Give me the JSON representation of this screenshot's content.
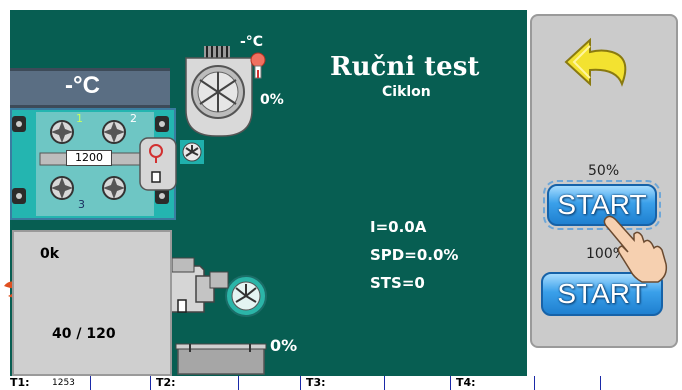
{
  "title": "Ručni test",
  "subtitle": "Ciklon",
  "boiler": {
    "temp": "-°C",
    "fan_speed": "1200",
    "pos": [
      "1",
      "2",
      "3"
    ],
    "fan_temp": "-°C",
    "fan_percent": "0%"
  },
  "burner": {
    "power": "0k",
    "level": "40 / 120",
    "feeder_percent": "0%",
    "motor_label": "▯"
  },
  "readings": {
    "current": "I=0.0A",
    "speed": "SPD=0.0%",
    "status": "STS=0"
  },
  "side": {
    "pct_a": "50%",
    "start_a": "START",
    "pct_b": "100%",
    "start_b": "START"
  },
  "status_bar": {
    "t1_label": "T1:",
    "t1_value": "1253",
    "t2_label": "T2:",
    "t3_label": "T3:",
    "t4_label": "T4:"
  },
  "colors": {
    "background": "#075e52",
    "panel": "#cbcbcb",
    "button": "#2d8fe0",
    "back_arrow": "#f0dc2a"
  },
  "icons": {
    "back": "back-arrow-icon",
    "hand": "hand-pointer-icon",
    "fan": "fan-icon",
    "flame": "flame-icon"
  }
}
